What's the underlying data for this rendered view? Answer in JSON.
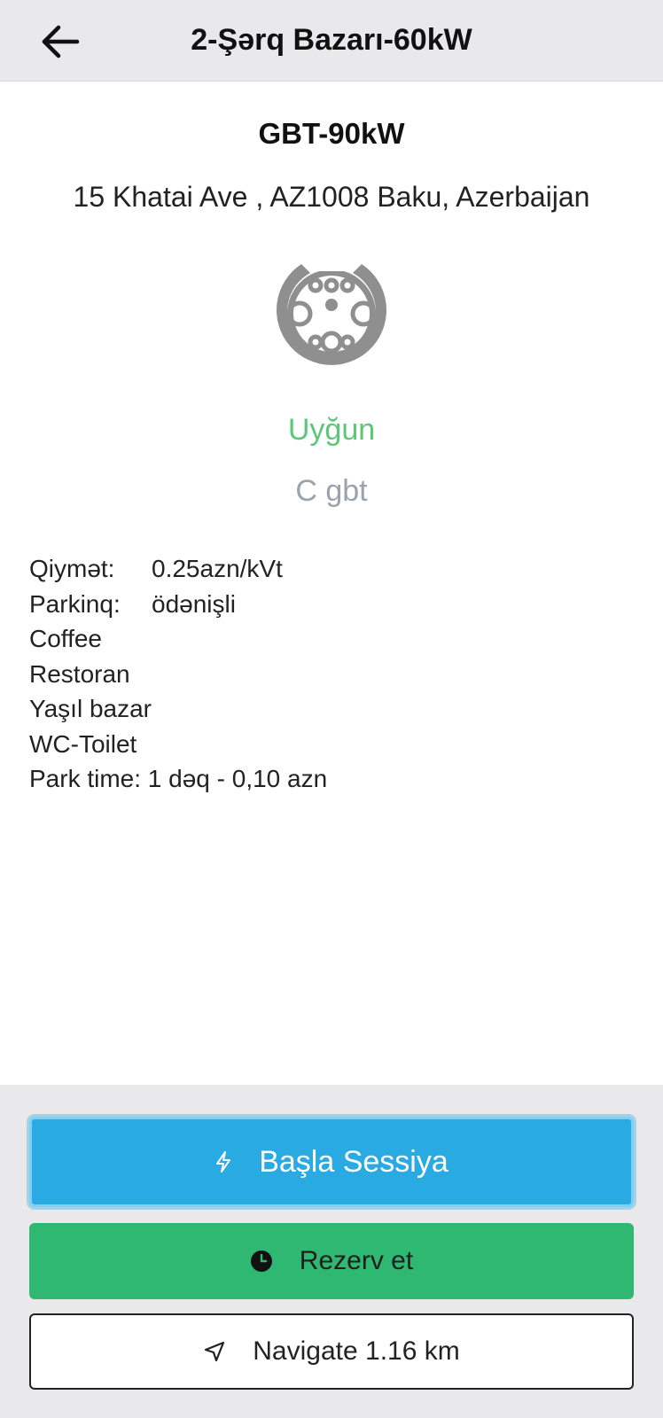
{
  "header": {
    "title": "2-Şərq Bazarı-60kW",
    "back_icon": "arrow-left-icon"
  },
  "connector": {
    "title": "GBT-90kW",
    "address": "15 Khatai Ave , AZ1008 Baku, Azerbaijan",
    "icon": "ev-plug-icon",
    "status": "Uyğun",
    "type": "C gbt",
    "status_color": "#5cc779"
  },
  "details": {
    "price_label": "Qiymət:",
    "price_value": "0.25azn/kVt",
    "parking_label": "Parkinq:",
    "parking_value": "ödənişli",
    "amenities": [
      "Coffee",
      "Restoran",
      "Yaşıl bazar",
      "WC-Toilet"
    ],
    "park_time": "Park time: 1 dəq - 0,10 azn"
  },
  "actions": {
    "start_label": "Başla Sessiya",
    "start_icon": "lightning-icon",
    "reserve_label": "Rezerv et",
    "reserve_icon": "clock-icon",
    "navigate_label": "Navigate 1.16 km",
    "navigate_icon": "navigation-arrow-icon"
  },
  "colors": {
    "start_button": "#2aaae2",
    "reserve_button": "#2eb872",
    "header_bg": "#e9e9ec"
  }
}
